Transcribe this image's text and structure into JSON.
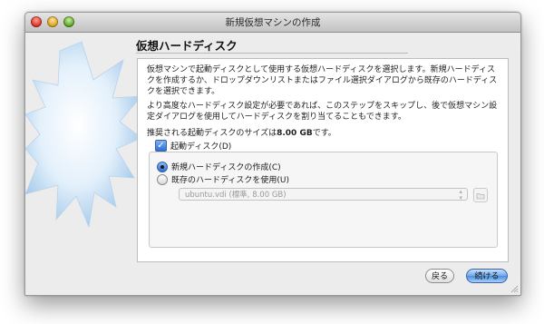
{
  "window": {
    "title": "新規仮想マシンの作成"
  },
  "page": {
    "title": "仮想ハードディスク",
    "description1": "仮想マシンで起動ディスクとして使用する仮想ハードディスクを選択します。新規ハードディスクを作成するか、ドロップダウンリストまたはファイル選択ダイアログから既存のハードディスクを選択できます。",
    "description2": "より高度なハードディスク設定が必要であれば、このステップをスキップし、後で仮想マシン設定ダイアログを使用してハードディスクを割り当てることもできます。",
    "recommend_prefix": "推奨される起動ディスクのサイズは",
    "recommend_size": "8.00 GB",
    "recommend_suffix": "です。"
  },
  "boot_disk": {
    "label": "起動ディスク(D)",
    "checked": true
  },
  "options": {
    "create_new": {
      "label": "新規ハードディスクの作成(C)",
      "selected": true
    },
    "use_existing": {
      "label": "既存のハードディスクを使用(U)",
      "selected": false
    },
    "existing_disk_value": "ubuntu.vdi (標準, 8.00 GB)"
  },
  "buttons": {
    "back": "戻る",
    "next": "続ける"
  },
  "icons": {
    "check": "✓",
    "select_arrows": [
      "▴",
      "▾"
    ]
  },
  "colors": {
    "accent": "#2d6fd8",
    "starburst": "#a9cdea"
  }
}
